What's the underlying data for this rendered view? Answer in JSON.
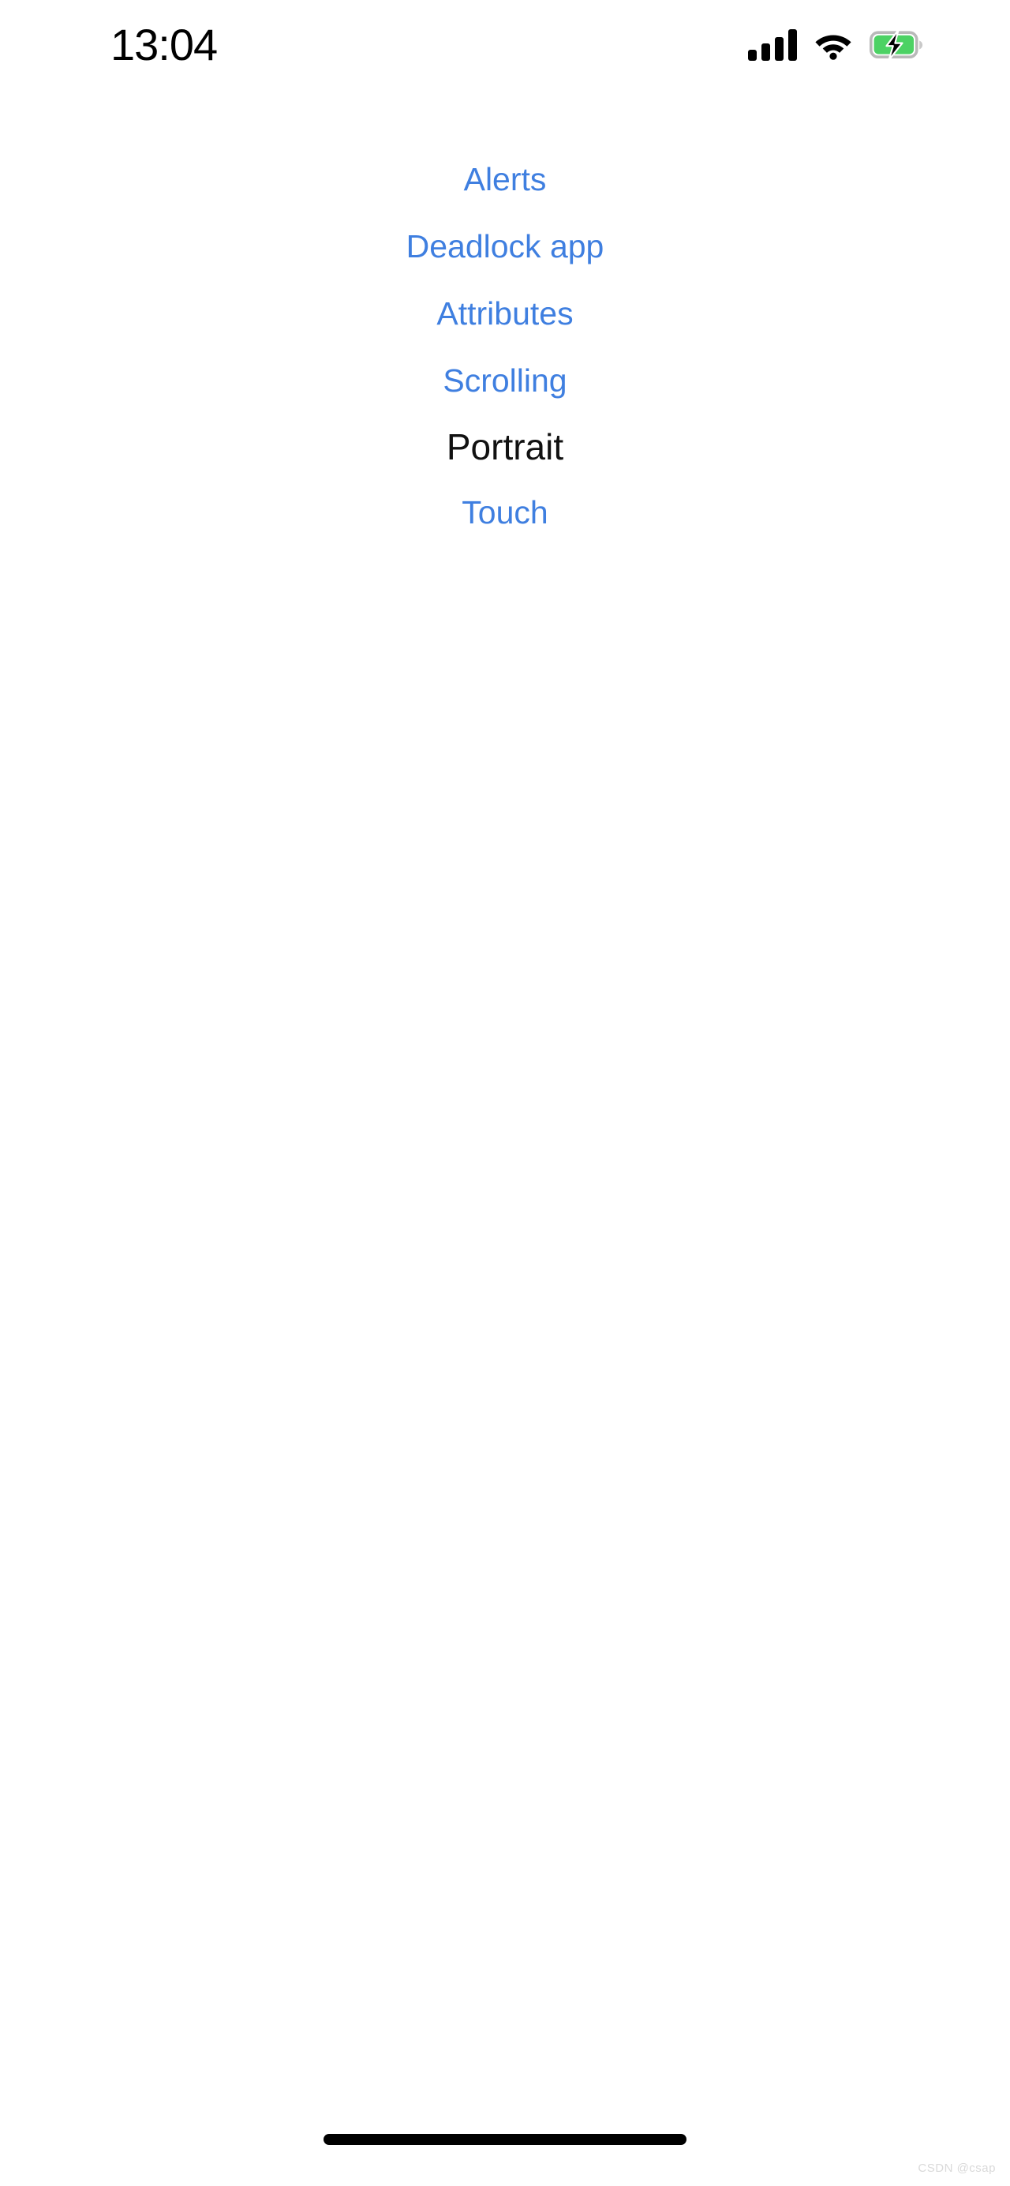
{
  "status_bar": {
    "clock": "13:04",
    "icons": {
      "signal": "signal-bars-icon",
      "signal_bars_count": 4,
      "wifi": "wifi-icon",
      "battery": "battery-charging-icon",
      "battery_state": "charging",
      "battery_color": "#4cd264"
    }
  },
  "menu": {
    "items": [
      {
        "label": "Alerts",
        "type": "link",
        "color": "#3f7fe0"
      },
      {
        "label": "Deadlock app",
        "type": "link",
        "color": "#3f7fe0"
      },
      {
        "label": "Attributes",
        "type": "link",
        "color": "#3f7fe0"
      },
      {
        "label": "Scrolling",
        "type": "link",
        "color": "#3f7fe0"
      },
      {
        "label": "Portrait",
        "type": "label",
        "color": "#111111"
      },
      {
        "label": "Touch",
        "type": "link",
        "color": "#3f7fe0"
      }
    ]
  },
  "footer": {
    "home_indicator": "home-indicator",
    "watermark": "CSDN @csap"
  },
  "theme": {
    "background": "#ffffff",
    "link_color": "#3f7fe0",
    "text_color": "#111111"
  }
}
